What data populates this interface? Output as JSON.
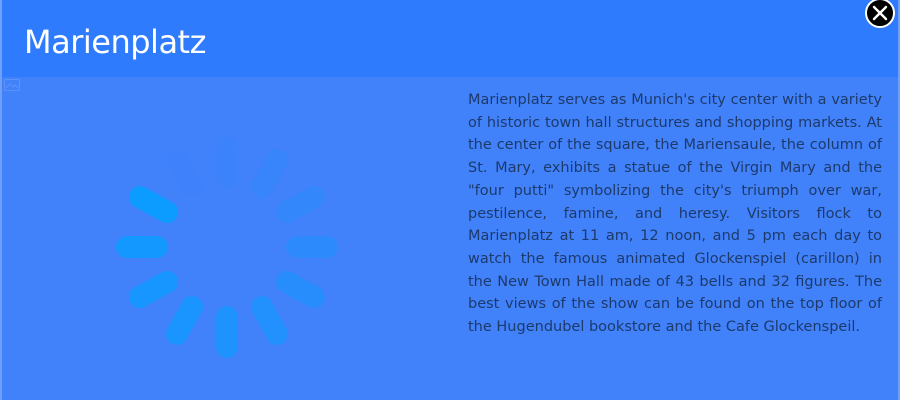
{
  "dialog": {
    "title": "Marienplatz",
    "description": "Marienplatz serves as Munich's city center with a variety of historic town hall structures and shopping markets. At the center of the square, the Mariensaule, the column of St. Mary, exhibits a statue of the Virgin Mary and the \"four putti\" symbolizing the city's triumph over war, pestilence, famine, and heresy. Visitors flock to Marienplatz at 11 am, 12 noon, and 5 pm each day to watch the famous animated Glockenspiel (carillon) in the New Town Hall made of 43 bells and 32 figures. The best views of the show can be found on the top floor of the Hugendubel bookstore and the Cafe Glockenspeil.",
    "close_icon": "close-icon",
    "loading_icon": "loading-spinner-icon",
    "broken_image_icon": "broken-image-icon"
  },
  "colors": {
    "header_background": "#2f7bfd",
    "body_background": "#4181fa",
    "spinner": "#0a9cff",
    "text": "#1d3a6b",
    "title": "#ffffff"
  }
}
